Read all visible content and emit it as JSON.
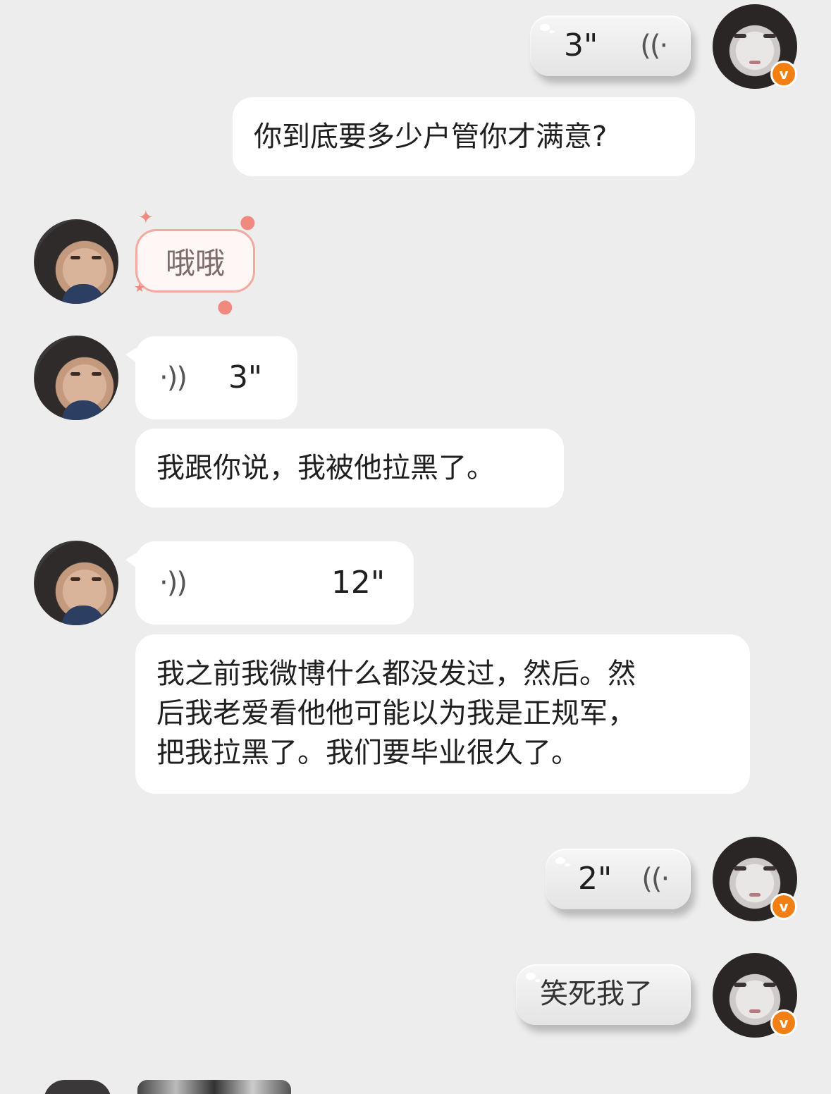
{
  "messages": [
    {
      "side": "right",
      "type": "voice",
      "duration": "3\""
    },
    {
      "side": "right",
      "type": "text",
      "text": "你到底要多少户管你才满意?"
    },
    {
      "side": "left",
      "type": "sticker",
      "text": "哦哦"
    },
    {
      "side": "left",
      "type": "voice",
      "duration": "3\""
    },
    {
      "side": "left",
      "type": "text",
      "text": "我跟你说，我被他拉黑了。"
    },
    {
      "side": "left",
      "type": "voice",
      "duration": "12\""
    },
    {
      "side": "left",
      "type": "text",
      "lines": [
        "我之前我微博什么都没发过，然后。然",
        "后我老爱看他他可能以为我是正规军，",
        "把我拉黑了。我们要毕业很久了。"
      ]
    },
    {
      "side": "right",
      "type": "voice",
      "duration": "2\""
    },
    {
      "side": "right",
      "type": "text",
      "text": "笑死我了"
    }
  ],
  "badge": {
    "label": "v",
    "color": "#f27f14"
  },
  "icons": {
    "voice_wave_left": "voice-wave-icon",
    "voice_wave_right": "voice-wave-icon"
  }
}
